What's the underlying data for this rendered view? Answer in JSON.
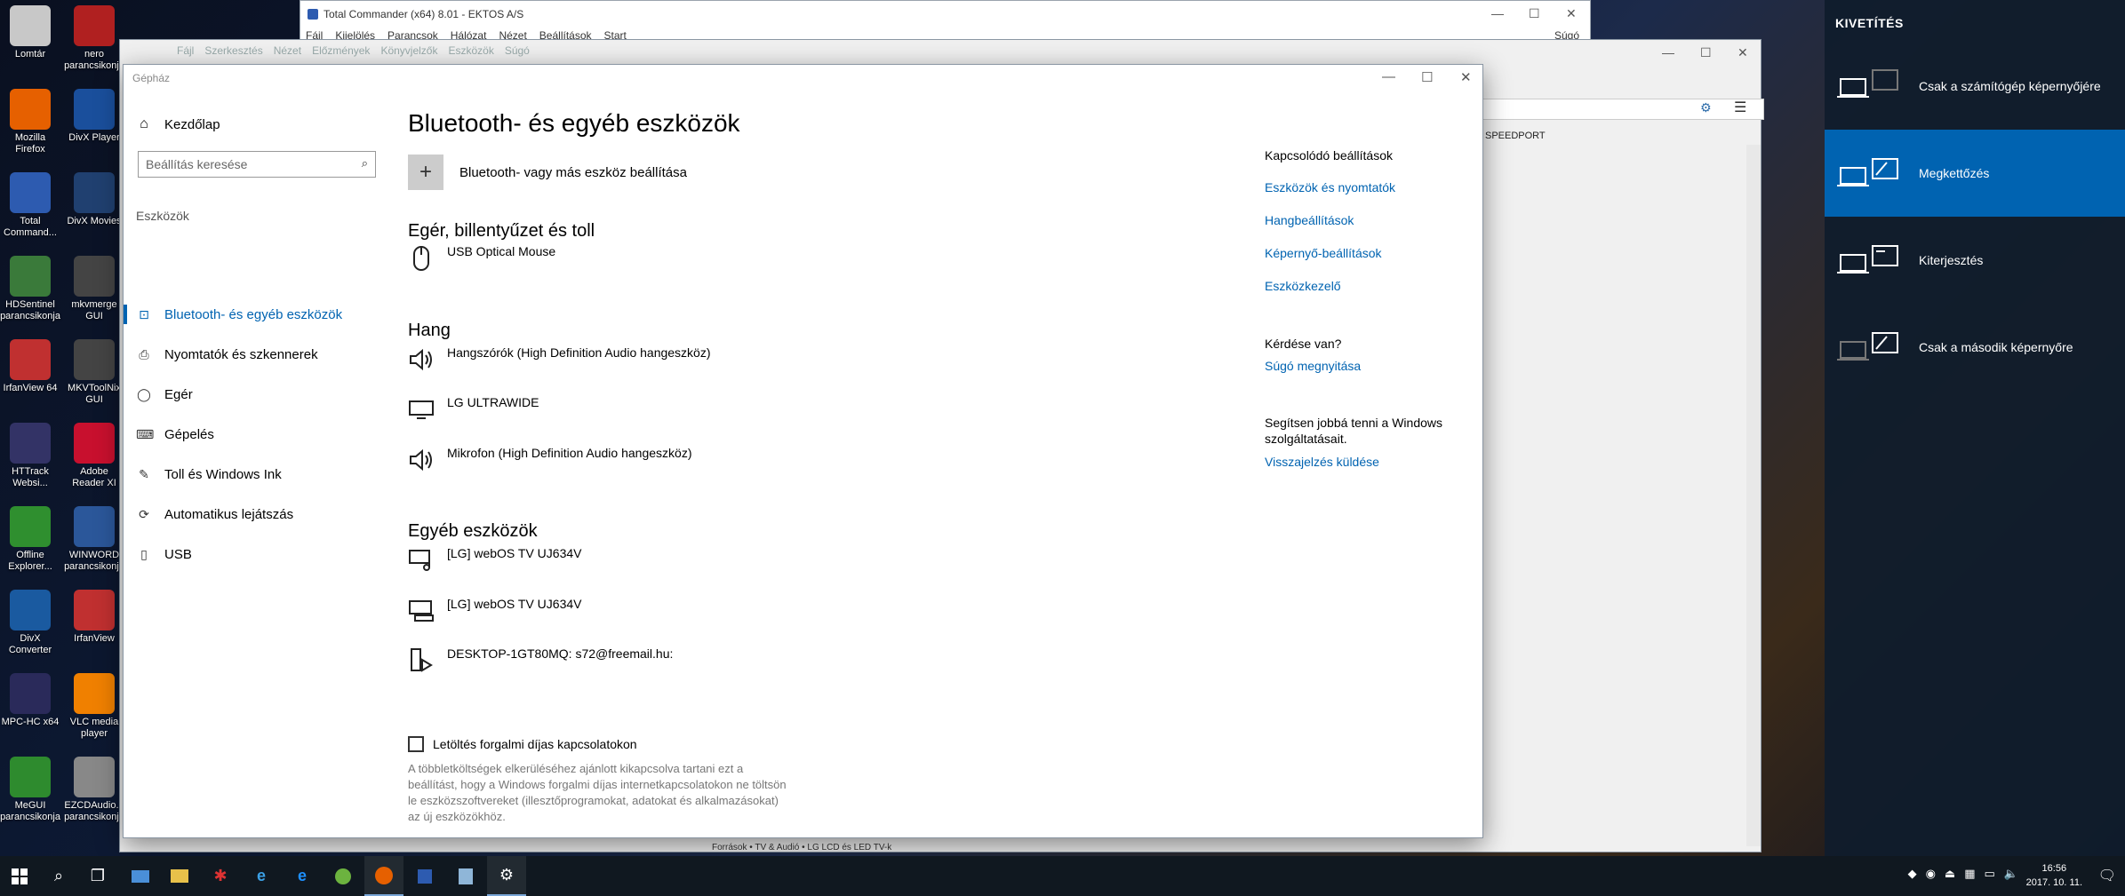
{
  "desktop_icons": [
    {
      "label": "Lomtár",
      "icon": "recycle-bin-icon",
      "color": "#c8c8c8"
    },
    {
      "label": "nero\nparancsikonja",
      "icon": "nero-icon",
      "color": "#b02020"
    },
    {
      "label": "Mozilla\nFirefox",
      "icon": "firefox-icon",
      "color": "#e66000"
    },
    {
      "label": "DivX Player",
      "icon": "divx-player-icon",
      "color": "#1a4f9c"
    },
    {
      "label": "Total\nCommand...",
      "icon": "total-commander-icon",
      "color": "#2d5bb0"
    },
    {
      "label": "DivX Movies",
      "icon": "divx-movies-icon",
      "color": "#204070"
    },
    {
      "label": "HDSentinel\nparancsikonja",
      "icon": "hdsentinel-icon",
      "color": "#3a7a3a"
    },
    {
      "label": "mkvmerge\nGUI",
      "icon": "mkvmerge-icon",
      "color": "#444"
    },
    {
      "label": "IrfanView 64",
      "icon": "irfanview64-icon",
      "color": "#c03030"
    },
    {
      "label": "MKVToolNix\nGUI",
      "icon": "mkvtoolnix-icon",
      "color": "#444"
    },
    {
      "label": "HTTrack\nWebsi...",
      "icon": "httrack-icon",
      "color": "#333366"
    },
    {
      "label": "Adobe\nReader XI",
      "icon": "adobe-reader-icon",
      "color": "#c8102e"
    },
    {
      "label": "Offline\nExplorer...",
      "icon": "offline-explorer-icon",
      "color": "#2f8f2f"
    },
    {
      "label": "WINWORD\nparancsikonja",
      "icon": "winword-icon",
      "color": "#2b579a"
    },
    {
      "label": "DivX\nConverter",
      "icon": "divx-converter-icon",
      "color": "#1a5aa0"
    },
    {
      "label": "IrfanView",
      "icon": "irfanview-icon",
      "color": "#c03030"
    },
    {
      "label": "MPC-HC x64",
      "icon": "mpc-hc-icon",
      "color": "#2a2a5a"
    },
    {
      "label": "VLC media\nplayer",
      "icon": "vlc-icon",
      "color": "#f08000"
    },
    {
      "label": "MeGUI\nparancsikonja",
      "icon": "megui-icon",
      "color": "#2e8b2e"
    },
    {
      "label": "EZCDAudio...\nparancsikonja",
      "icon": "ezcdaudio-icon",
      "color": "#888"
    }
  ],
  "total_commander": {
    "title": "Total Commander (x64) 8.01 - EKTOS A/S",
    "menu": [
      "Fájl",
      "Kijelölés",
      "Parancsok",
      "Hálózat",
      "Nézet",
      "Beállítások",
      "Start"
    ],
    "help": "Súgó"
  },
  "device_manager": {
    "menu": [
      "Fájl",
      "Szerkesztés",
      "Nézet",
      "Előzmények",
      "Könyvjelzők",
      "Eszközök",
      "Súgó"
    ],
    "tab_label": "SPEEDPORT",
    "status_line": "Források • TV & Audió • LG LCD és LED TV-k"
  },
  "settings": {
    "window_title": "Gépház",
    "nav": {
      "home": "Kezdőlap",
      "search_placeholder": "Beállítás keresése",
      "section": "Eszközök",
      "items": [
        {
          "label": "Bluetooth- és egyéb eszközök",
          "icon": "bluetooth-devices-icon",
          "glyph": "⊡",
          "active": true
        },
        {
          "label": "Nyomtatók és szkennerek",
          "icon": "printer-icon",
          "glyph": "⎙",
          "active": false
        },
        {
          "label": "Egér",
          "icon": "mouse-icon",
          "glyph": "◯",
          "active": false
        },
        {
          "label": "Gépelés",
          "icon": "keyboard-icon",
          "glyph": "⌨",
          "active": false
        },
        {
          "label": "Toll és Windows Ink",
          "icon": "pen-icon",
          "glyph": "✎",
          "active": false
        },
        {
          "label": "Automatikus lejátszás",
          "icon": "autoplay-icon",
          "glyph": "⟳",
          "active": false
        },
        {
          "label": "USB",
          "icon": "usb-icon",
          "glyph": "▯",
          "active": false
        }
      ]
    },
    "main": {
      "title": "Bluetooth- és egyéb eszközök",
      "add_device": "Bluetooth- vagy más eszköz beállítása",
      "groups": [
        {
          "heading": "Egér, billentyűzet és toll",
          "devices": [
            {
              "name": "USB Optical Mouse",
              "icon": "mouse-icon"
            }
          ]
        },
        {
          "heading": "Hang",
          "devices": [
            {
              "name": "Hangszórók (High Definition Audio hangeszköz)",
              "icon": "speaker-icon"
            },
            {
              "name": "LG ULTRAWIDE",
              "icon": "monitor-icon"
            },
            {
              "name": "Mikrofon (High Definition Audio hangeszköz)",
              "icon": "speaker-icon"
            }
          ]
        },
        {
          "heading": "Egyéb eszközök",
          "devices": [
            {
              "name": "[LG] webOS TV UJ634V",
              "icon": "media-device-icon"
            },
            {
              "name": "[LG] webOS TV UJ634V",
              "icon": "display-device-icon"
            },
            {
              "name": "DESKTOP-1GT80MQ: s72@freemail.hu:",
              "icon": "media-server-icon"
            }
          ]
        }
      ],
      "metered_label": "Letöltés forgalmi díjas kapcsolatokon",
      "metered_desc": "A többletköltségek elkerüléséhez ajánlott kikapcsolva tartani ezt a beállítást, hogy a Windows forgalmi díjas internetkapcsolatokon ne töltsön le eszközszoftvereket (illesztőprogramokat, adatokat és alkalmazásokat) az új eszközökhöz.",
      "metered_checked": false
    },
    "related": {
      "heading": "Kapcsolódó beállítások",
      "links": [
        "Eszközök és nyomtatók",
        "Hangbeállítások",
        "Képernyő-beállítások",
        "Eszközkezelő"
      ],
      "question": "Kérdése van?",
      "help_link": "Súgó megnyitása",
      "improve_text": "Segítsen jobbá tenni a Windows szolgáltatásait.",
      "feedback_link": "Visszajelzés küldése"
    }
  },
  "projection": {
    "heading": "KIVETÍTÉS",
    "options": [
      {
        "label": "Csak a számítógép képernyőjére",
        "active": false
      },
      {
        "label": "Megkettőzés",
        "active": true
      },
      {
        "label": "Kiterjesztés",
        "active": false
      },
      {
        "label": "Csak a második képernyőre",
        "active": false
      }
    ]
  },
  "taskbar": {
    "clock_time": "16:56",
    "clock_date": "2017. 10. 11."
  },
  "colors": {
    "accent": "#0063b1",
    "projection_bg": "#101c2c",
    "taskbar_bg": "#101820"
  }
}
